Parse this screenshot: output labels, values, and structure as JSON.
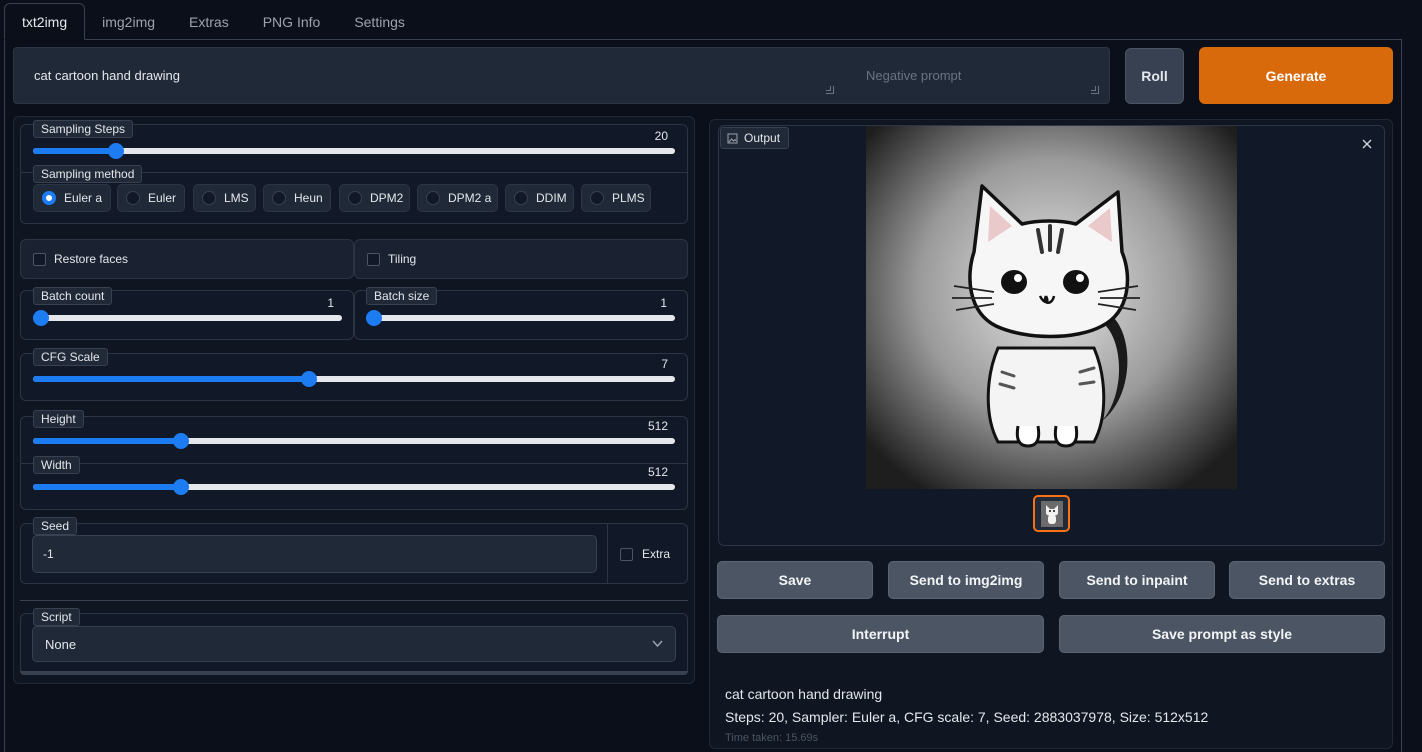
{
  "tabs": [
    {
      "label": "txt2img",
      "active": true
    },
    {
      "label": "img2img"
    },
    {
      "label": "Extras"
    },
    {
      "label": "PNG Info"
    },
    {
      "label": "Settings"
    }
  ],
  "prompt": {
    "value": "cat cartoon hand drawing",
    "negative_placeholder": "Negative prompt"
  },
  "buttons": {
    "roll": "Roll",
    "generate": "Generate"
  },
  "sampling_steps": {
    "label": "Sampling Steps",
    "value": "20",
    "fraction": 0.13
  },
  "sampling_method": {
    "label": "Sampling method",
    "options": [
      "Euler a",
      "Euler",
      "LMS",
      "Heun",
      "DPM2",
      "DPM2 a",
      "DDIM",
      "PLMS"
    ],
    "selected": "Euler a"
  },
  "restore_faces": {
    "label": "Restore faces",
    "checked": false
  },
  "tiling": {
    "label": "Tiling",
    "checked": false
  },
  "batch_count": {
    "label": "Batch count",
    "value": "1",
    "fraction": 0.0
  },
  "batch_size": {
    "label": "Batch size",
    "value": "1",
    "fraction": 0.0
  },
  "cfg_scale": {
    "label": "CFG Scale",
    "value": "7",
    "fraction": 0.43
  },
  "height": {
    "label": "Height",
    "value": "512",
    "fraction": 0.23
  },
  "width": {
    "label": "Width",
    "value": "512",
    "fraction": 0.23
  },
  "seed": {
    "label": "Seed",
    "value": "-1",
    "extra_label": "Extra"
  },
  "script": {
    "label": "Script",
    "selected": "None"
  },
  "output": {
    "label": "Output"
  },
  "output_buttons": {
    "save": "Save",
    "send_img2img": "Send to img2img",
    "send_inpaint": "Send to inpaint",
    "send_extras": "Send to extras",
    "interrupt": "Interrupt",
    "save_style": "Save prompt as style"
  },
  "generation_info": {
    "prompt": "cat cartoon hand drawing",
    "params": "Steps: 20, Sampler: Euler a, CFG scale: 7, Seed: 2883037978, Size: 512x512",
    "time": "Time taken: 15.69s"
  },
  "colors": {
    "accent": "#1d7cf2",
    "generate": "#d96a0c",
    "background": "#0b0f19"
  }
}
